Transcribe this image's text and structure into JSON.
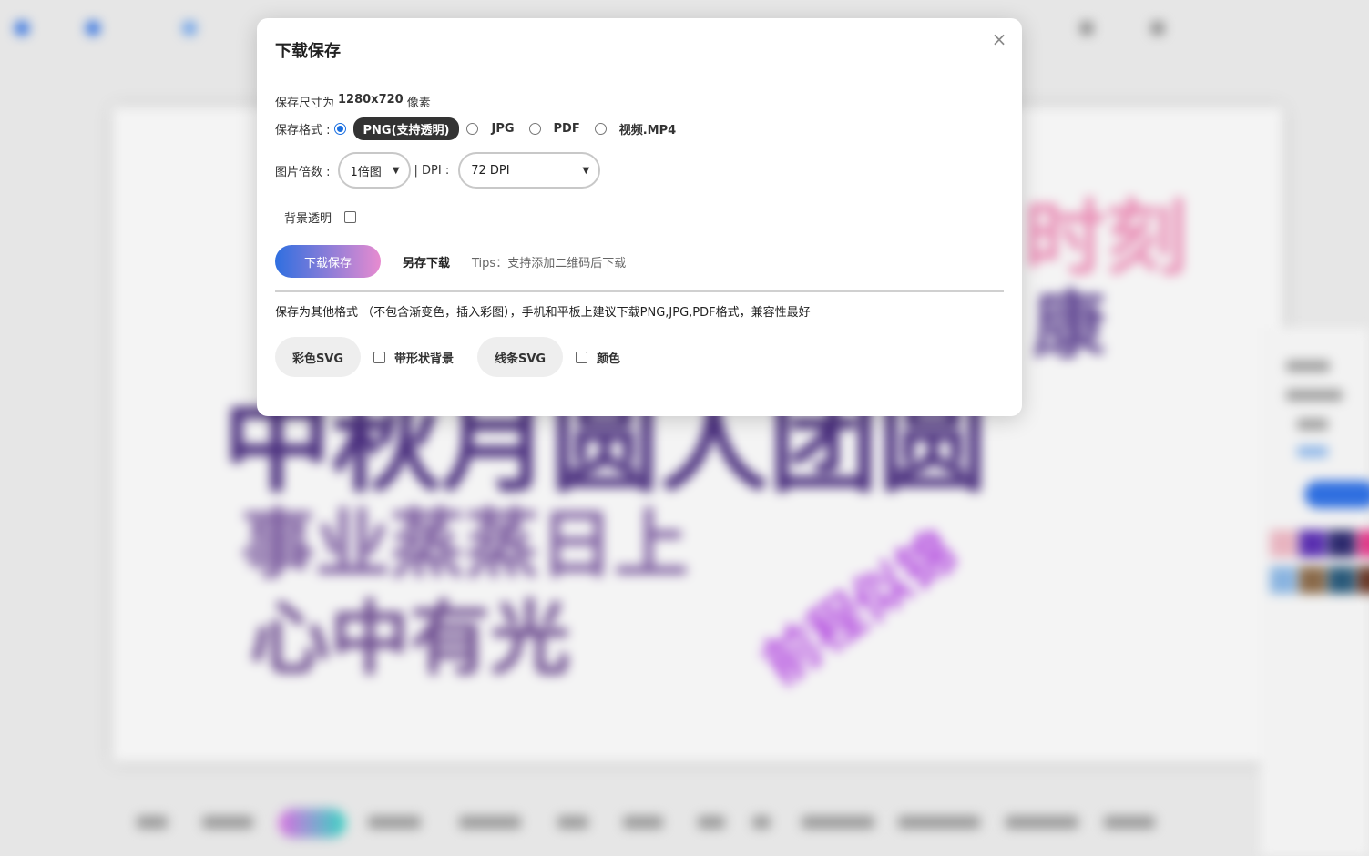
{
  "background": {
    "nav_items": [
      "",
      "",
      ""
    ],
    "wordcloud_words": [
      {
        "text": "中秋月圆人团圆",
        "color": "#4a2f7e"
      },
      {
        "text": "事业蒸蒸日上",
        "color": "#7a5a9e"
      },
      {
        "text": "心中有光",
        "color": "#6b4a8e"
      },
      {
        "text": "时刻",
        "color": "#e98fb6"
      },
      {
        "text": "前程似锦",
        "color": "#b44de0"
      },
      {
        "text": "康",
        "color": "#5a3f8e"
      }
    ],
    "swatch_colors": [
      "#e8b4c0",
      "#5a2fb0",
      "#2d2a6e",
      "#e03c8a",
      "#8ab4e0",
      "#8a6a4a",
      "#2a5a7a",
      "#6a3a2a"
    ]
  },
  "modal": {
    "title": "下载保存",
    "close_icon": "close-icon",
    "size_label": "保存尺寸为",
    "size_value": "1280x720",
    "size_unit": "像素",
    "format_label": "保存格式 :",
    "formats": {
      "png": "PNG(支持透明)",
      "jpg": "JPG",
      "pdf": "PDF",
      "mp4": "视频.MP4"
    },
    "selected_format": "png",
    "scale_label": "图片倍数 :",
    "scale_value": "1倍图",
    "dpi_label": "| DPI :",
    "dpi_value": "72 DPI",
    "transparent_label": "背景透明",
    "transparent_checked": false,
    "download_button": "下载保存",
    "save_as_link": "另存下载",
    "tips": "Tips：支持添加二维码后下载",
    "other_formats_note": "保存为其他格式 （不包含渐变色，插入彩图），手机和平板上建议下载PNG,JPG,PDF格式，兼容性最好",
    "color_svg_button": "彩色SVG",
    "shape_bg_label": "带形状背景",
    "line_svg_button": "线条SVG",
    "color_label": "颜色"
  }
}
